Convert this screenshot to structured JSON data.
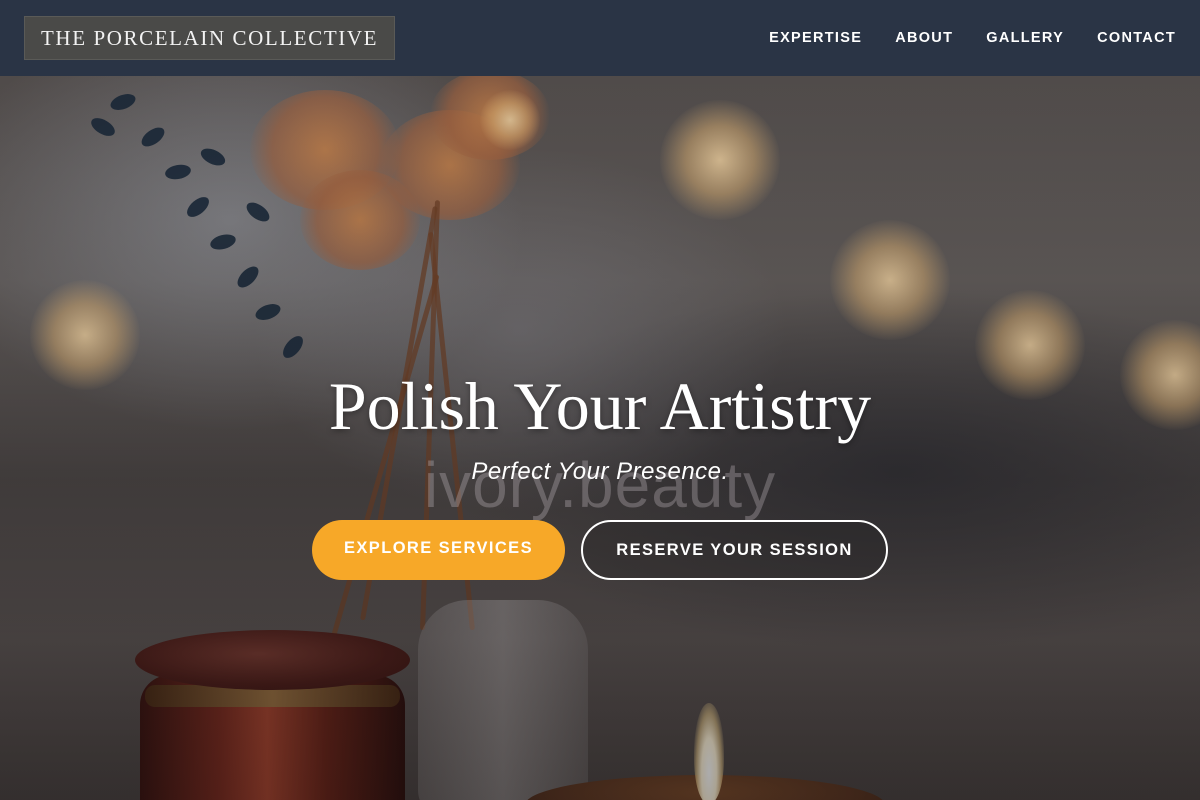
{
  "brand": {
    "name": "THE PORCELAIN COLLECTIVE"
  },
  "nav": {
    "items": [
      {
        "label": "EXPERTISE"
      },
      {
        "label": "ABOUT"
      },
      {
        "label": "GALLERY"
      },
      {
        "label": "CONTACT"
      }
    ]
  },
  "hero": {
    "title": "Polish Your Artistry",
    "subtitle": "Perfect Your Presence.",
    "watermark": "ivory.beauty",
    "primary_cta": "EXPLORE SERVICES",
    "secondary_cta": "RESERVE YOUR SESSION"
  },
  "colors": {
    "navbar_bg": "#2a3445",
    "brand_bg": "#4a4a48",
    "primary_button": "#f7a828",
    "text": "#ffffff"
  }
}
